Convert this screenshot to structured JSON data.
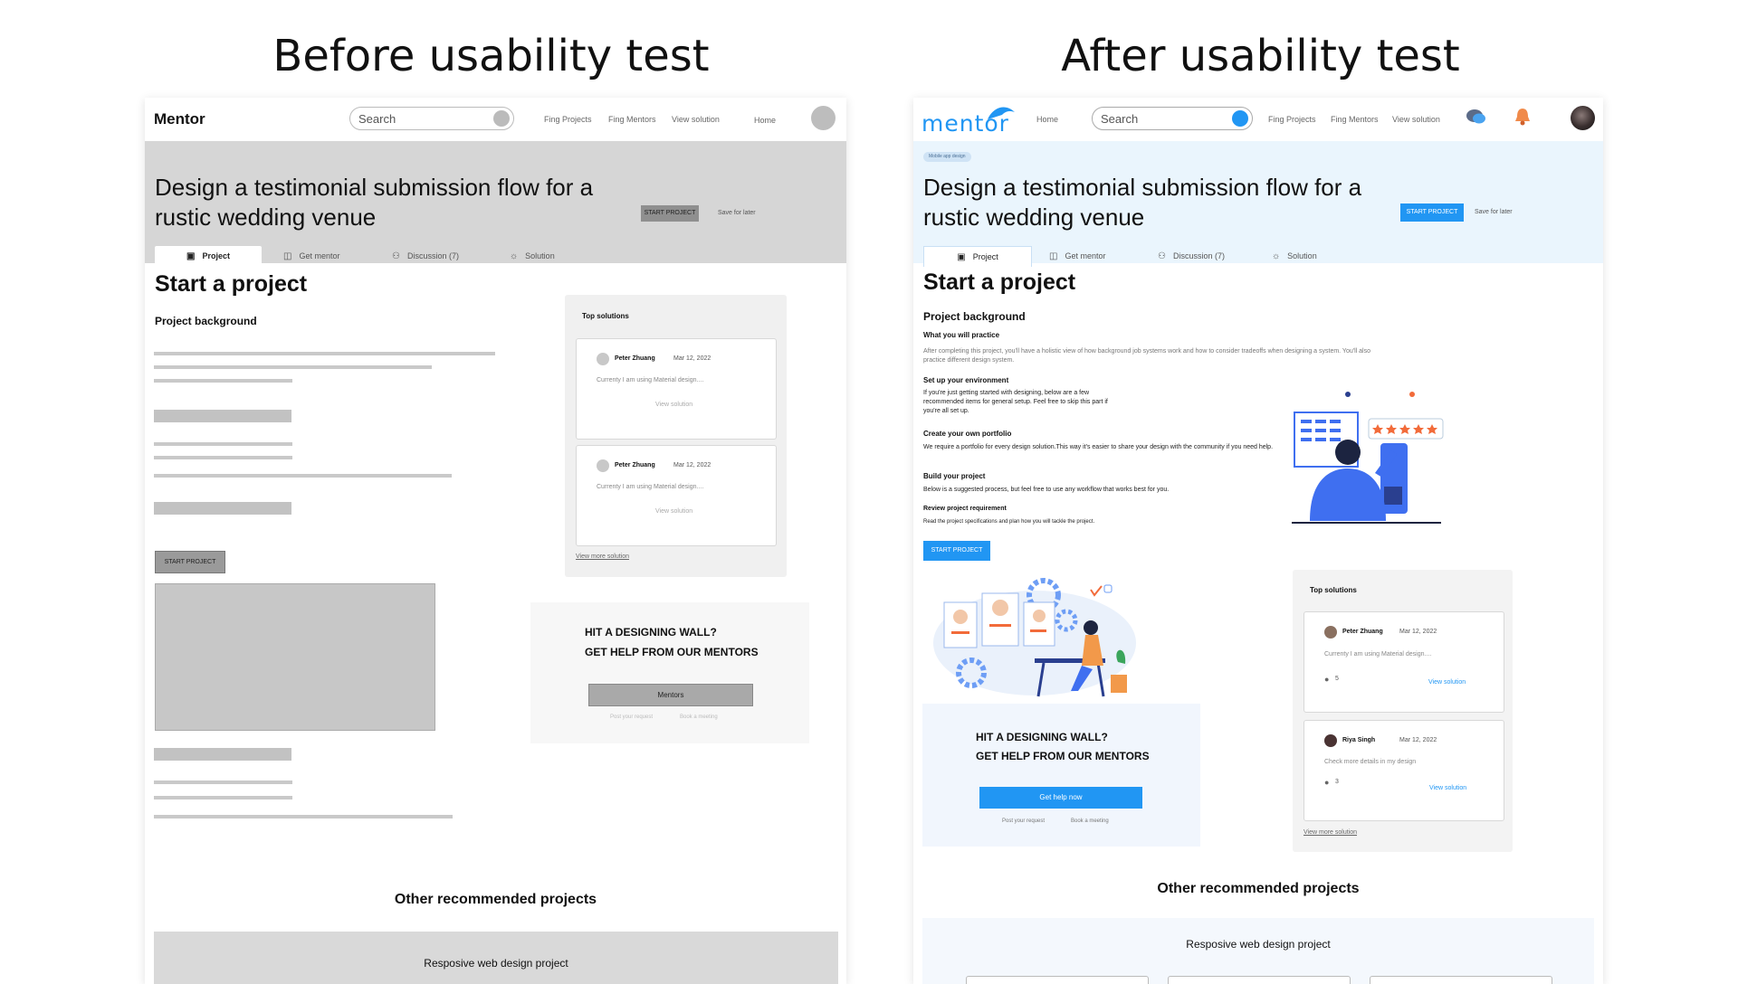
{
  "headings": {
    "before": "Before usability test",
    "after": "After usability test"
  },
  "before": {
    "nav": {
      "brand": "Mentor",
      "search_placeholder": "Search",
      "links": [
        "Fing Projects",
        "Fing Mentors",
        "View solution",
        "Home"
      ]
    },
    "hero": {
      "title": "Design a testimonial submission flow for a rustic wedding venue",
      "start_button": "START PROJECT",
      "save_later": "Save for later"
    },
    "tabs": [
      "Project",
      "Get mentor",
      "Discussion (7)",
      "Solution"
    ],
    "main": {
      "title": "Start a project",
      "subtitle": "Project background",
      "start_button": "START PROJECT"
    },
    "top_solutions": {
      "title": "Top solutions",
      "cards": [
        {
          "name": "Peter Zhuang",
          "date": "Mar 12, 2022",
          "text": "Currenty I am using Material design....",
          "link": "View solution"
        },
        {
          "name": "Peter Zhuang",
          "date": "Mar 12, 2022",
          "text": "Currenty I am using Material design....",
          "link": "View solution"
        }
      ],
      "more": "View more solution"
    },
    "help": {
      "line1": "HIT  A DESIGNING WALL?",
      "line2": "GET HELP FROM OUR MENTORS",
      "button": "Mentors",
      "post": "Post your request",
      "book": "Book a meeting"
    },
    "other": {
      "title": "Other recommended projects",
      "card_title": "Resposive web design project"
    }
  },
  "after": {
    "nav": {
      "brand": "mentor",
      "home": "Home",
      "search_placeholder": "Search",
      "links": [
        "Fing Projects",
        "Fing Mentors",
        "View solution"
      ]
    },
    "hero": {
      "badge": "Mobile app design",
      "title": "Design a testimonial submission flow for a rustic wedding venue",
      "start_button": "START PROJECT",
      "save_later": "Save for later"
    },
    "tabs": [
      "Project",
      "Get mentor",
      "Discussion (7)",
      "Solution"
    ],
    "main": {
      "title": "Start a project",
      "subtitle": "Project background",
      "sections": [
        {
          "heading": "What you will practice",
          "body": "After completing this project, you'll have a holistic view of how background job systems work and how to consider tradeoffs when designing a system. You'll also practice different design system."
        },
        {
          "heading": "Set up your environment",
          "body": "If you're just getting started with designing, below are a few recommended items for general setup. Feel free to skip this part if you're all set up."
        },
        {
          "heading": "Create your own portfolio",
          "body": "We require a portfolio for every design solution.This way it's easier to share your design with the community if you need help."
        },
        {
          "heading": "Build your project",
          "body": "Below is a suggested process, but feel free to use any workflow that works best for you."
        },
        {
          "heading": "Review project requirement",
          "body": "Read the project specifications and plan how you will tackle the project."
        }
      ],
      "start_button": "START PROJECT"
    },
    "top_solutions": {
      "title": "Top solutions",
      "cards": [
        {
          "name": "Peter Zhuang",
          "date": "Mar 12, 2022",
          "text": "Currenty I am using Material design....",
          "comments": "5",
          "link": "View solution"
        },
        {
          "name": "Riya Singh",
          "date": "Mar 12, 2022",
          "text": "Check more details in my design",
          "comments": "3",
          "link": "View solution"
        }
      ],
      "more": "View more solution"
    },
    "help": {
      "line1": "HIT  A DESIGNING WALL?",
      "line2": "GET HELP FROM OUR MENTORS",
      "button": "Get help now",
      "post": "Post your request",
      "book": "Book a meeting"
    },
    "other": {
      "title": "Other recommended projects",
      "card_title": "Resposive web design project"
    },
    "colors": {
      "accent": "#2196F3",
      "hero_bg": "#EAF5FD",
      "star": "#F26B3A",
      "illustration_blue": "#3F6FF0"
    },
    "icons": [
      "chat-icon",
      "bell-icon",
      "profile-avatar"
    ]
  }
}
